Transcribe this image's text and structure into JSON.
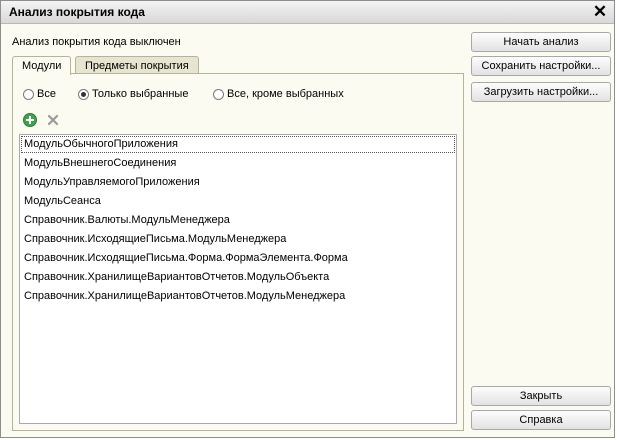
{
  "window": {
    "title": "Анализ покрытия кода",
    "close_label": "✕"
  },
  "status": "Анализ покрытия кода выключен",
  "tabs": [
    {
      "label": "Модули",
      "active": true
    },
    {
      "label": "Предметы покрытия",
      "active": false
    }
  ],
  "filter": {
    "options": [
      "Все",
      "Только выбранные",
      "Все, кроме выбранных"
    ],
    "selected": "Только выбранные"
  },
  "toolbar": {
    "add_icon": "add-icon",
    "delete_icon": "delete-icon"
  },
  "modules": [
    "МодульОбычногоПриложения",
    "МодульВнешнегоСоединения",
    "МодульУправляемогоПриложения",
    "МодульСеанса",
    "Справочник.Валюты.МодульМенеджера",
    "Справочник.ИсходящиеПисьма.МодульМенеджера",
    "Справочник.ИсходящиеПисьма.Форма.ФормаЭлемента.Форма",
    "Справочник.ХранилищеВариантовОтчетов.МодульОбъекта",
    "Справочник.ХранилищеВариантовОтчетов.МодульМенеджера"
  ],
  "selected_module": "МодульОбычногоПриложения",
  "buttons": {
    "start": "Начать анализ",
    "save": "Сохранить настройки...",
    "load": "Загрузить настройки...",
    "close": "Закрыть",
    "help": "Справка"
  },
  "colors": {
    "window_bg": "#fbfbf1",
    "add_icon": "#3fa34d",
    "delete_icon": "#9a9a9a"
  }
}
